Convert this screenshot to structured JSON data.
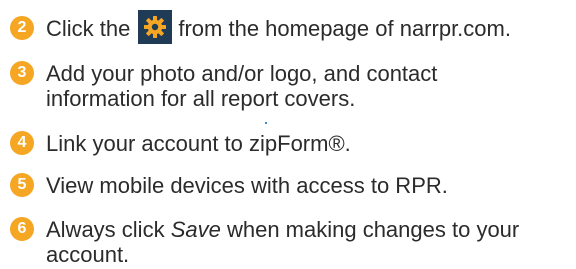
{
  "steps": [
    {
      "number": "2",
      "text_before": "Click the",
      "icon": "gear-icon",
      "text_after": "from the homepage of narrpr.com."
    },
    {
      "number": "3",
      "line1": "Add your photo and/or logo, and contact",
      "line2": "information for all report covers."
    },
    {
      "number": "4",
      "text": "Link your account to zipForm®."
    },
    {
      "number": "5",
      "text": "View mobile devices with access to RPR."
    },
    {
      "number": "6",
      "line1_before": "Always click ",
      "line1_em": "Save",
      "line1_after": " when making changes to your",
      "line2": "account."
    }
  ],
  "colors": {
    "badge": "#f5a623",
    "gear_box": "#1f3b55",
    "gear": "#f5a623",
    "text": "#2b2b2b"
  }
}
